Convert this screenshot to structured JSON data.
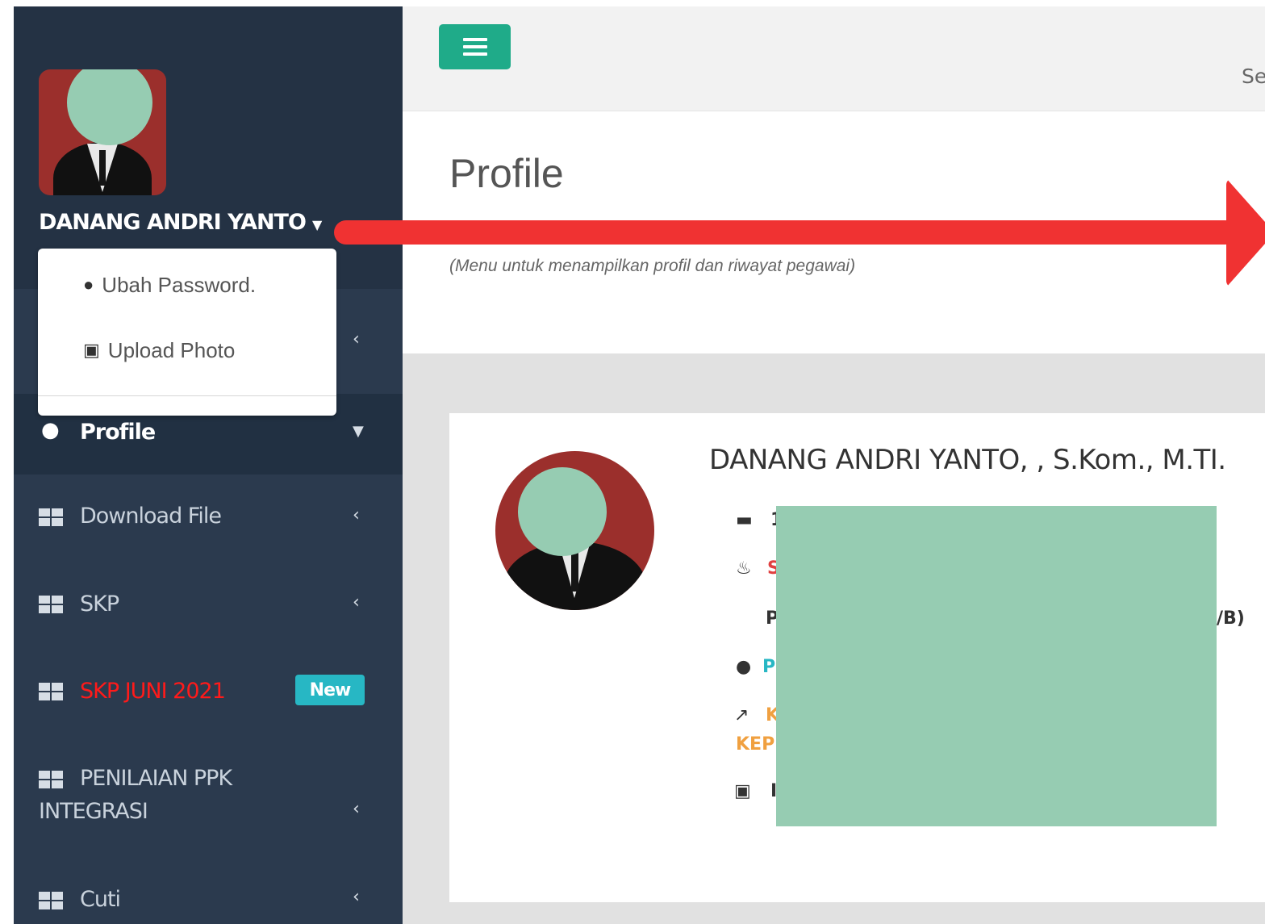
{
  "sidebar": {
    "user_name": "DANANG ANDRI YANTO",
    "dropdown": {
      "change_password": "Ubah Password.",
      "upload_photo": "Upload Photo"
    },
    "menu": {
      "profile": "Profile",
      "download_file": "Download File",
      "skp": "SKP",
      "skp_juni": "SKP JUNI 2021",
      "skp_juni_badge": "New",
      "penilaian_line1": "PENILAIAN PPK",
      "penilaian_line2": "INTEGRASI",
      "cuti": "Cuti"
    }
  },
  "header": {
    "right_text": "Se"
  },
  "page": {
    "title": "Profile",
    "subtitle": "(Menu untuk menampilkan profil dan riwayat pegawai)"
  },
  "profile": {
    "full_name": "DANANG ANDRI YANTO, , S.Kom., M.TI.",
    "row_id_char": "1",
    "row_birth_char": "S",
    "row_rank_left": "P",
    "row_rank_right": "/B)",
    "row_location_char": "P",
    "row_position_char": "K",
    "row_position_line2": "KEP",
    "row_salary_char": "I"
  },
  "colors": {
    "sidebar_bg": "#2b3a4e",
    "accent_green": "#1fab89",
    "badge_cyan": "#27b7c4",
    "highlight_red": "#f03232",
    "menu_red": "#ff1a1a"
  }
}
